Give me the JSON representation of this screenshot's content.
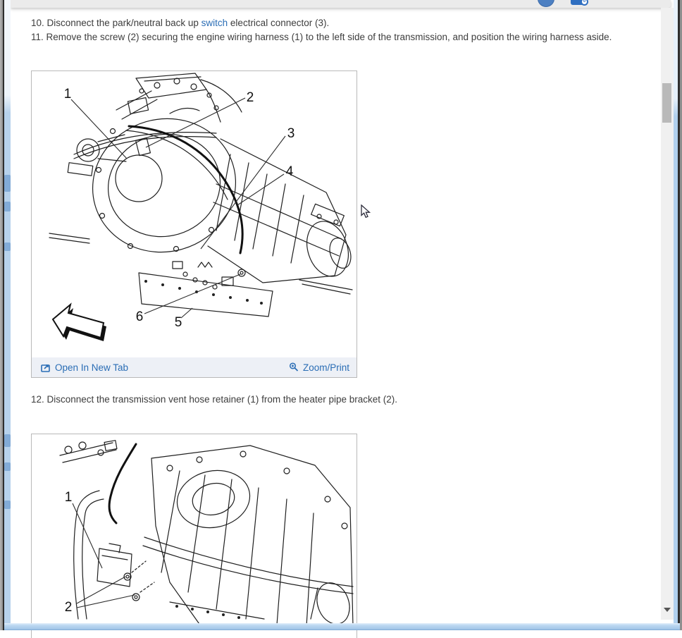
{
  "topbar": {
    "badge_count": "0"
  },
  "steps": {
    "s10": {
      "prefix": "10. Disconnect the park/neutral back up ",
      "link_text": "switch",
      "suffix": " electrical connector (3)."
    },
    "s11": {
      "text": "11. Remove the screw (2) securing the engine wiring harness (1) to the left side of the transmission, and position the wiring harness aside."
    },
    "s12": {
      "text": "12. Disconnect the transmission vent hose retainer (1) from the heater pipe bracket (2)."
    }
  },
  "figure1": {
    "callouts": {
      "c1": "1",
      "c2": "2",
      "c3": "3",
      "c4": "4",
      "c5": "5",
      "c6": "6"
    },
    "links": {
      "open_in_new_tab": "Open In New Tab",
      "zoom_print": "Zoom/Print"
    }
  },
  "figure2": {
    "callouts": {
      "c1": "1",
      "c2": "2"
    }
  },
  "icons": {
    "open_new_tab": "open-in-new-tab-icon",
    "zoom": "magnifier-plus-icon",
    "avatar": "user-avatar-icon",
    "camera_badge": "camera-badge-icon",
    "scroll_down": "scroll-down-arrow-icon"
  },
  "colors": {
    "link_blue": "#2a6db5",
    "window_border_blue": "#b7d2ec",
    "avatar_blue": "#4d80c2",
    "body_text": "#3d3d3d",
    "figure_footer_bg": "#edf0f6"
  }
}
